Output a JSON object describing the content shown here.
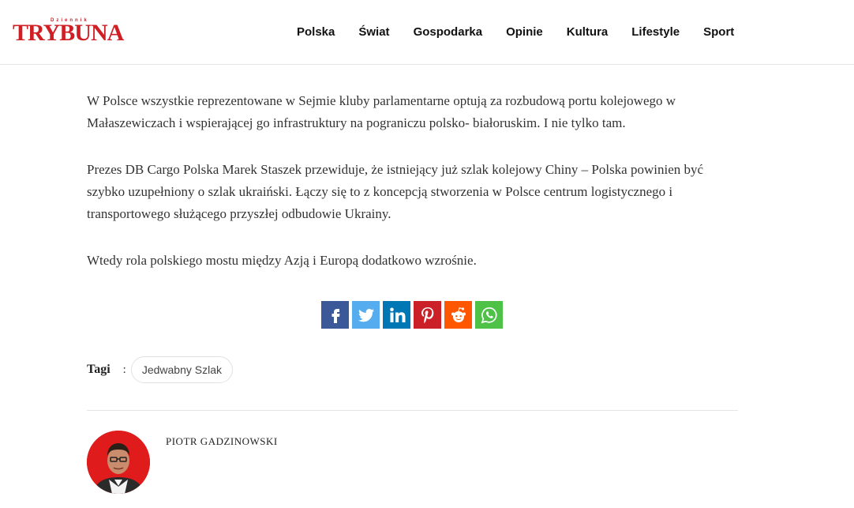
{
  "header": {
    "logo": {
      "sub": "Dziennik",
      "text": "TRYBUNA"
    },
    "nav": [
      "Polska",
      "Świat",
      "Gospodarka",
      "Opinie",
      "Kultura",
      "Lifestyle",
      "Sport"
    ]
  },
  "article": {
    "paragraphs": [
      "W Polsce wszystkie reprezentowane w Sejmie kluby parlamentarne optują za rozbudową portu kolejowego w Małaszewiczach i wspierającej go infrastruktury na pograniczu polsko- białoruskim. I nie tylko tam.",
      "Prezes DB Cargo Polska Marek Staszek przewiduje, że istniejący już szlak kolejowy Chiny – Polska powinien być szybko uzupełniony o  szlak ukraiński. Łączy się to z koncepcją stworzenia w Polsce centrum logistycznego i transportowego służącego przyszłej odbudowie Ukrainy.",
      "Wtedy rola polskiego mostu między Azją i Europą dodatkowo wzrośnie."
    ]
  },
  "share": [
    {
      "icon": "facebook-icon",
      "color": "#3b5998"
    },
    {
      "icon": "twitter-icon",
      "color": "#55acee"
    },
    {
      "icon": "linkedin-icon",
      "color": "#0077b5"
    },
    {
      "icon": "pinterest-icon",
      "color": "#cb2027"
    },
    {
      "icon": "reddit-icon",
      "color": "#ff5700"
    },
    {
      "icon": "whatsapp-icon",
      "color": "#4dc247"
    }
  ],
  "tags": {
    "label": "Tagi",
    "colon": ":",
    "items": [
      "Jedwabny Szlak"
    ]
  },
  "author": {
    "name": "PIOTR GADZINOWSKI"
  },
  "colors": {
    "brand": "#cf1f25"
  }
}
